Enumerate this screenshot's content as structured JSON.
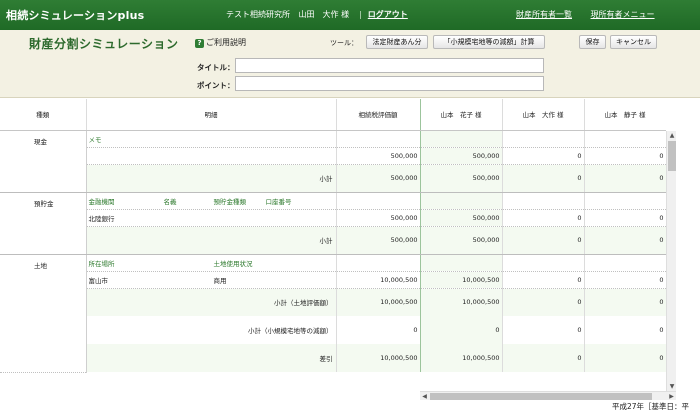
{
  "header": {
    "app_title": "相続シミュレーションplus",
    "office": "テスト相続研究所",
    "user_name": "山田　大作 様",
    "logout": "ログアウト",
    "nav": {
      "property_owner_list": "財産所有者一覧",
      "owner_menu": "現所有者メニュー"
    }
  },
  "subheader": {
    "page_title": "財産分割シミュレーション",
    "help": "ご利用説明",
    "tools_label": "ツール：",
    "tool_legal_share": "法定財産あん分",
    "tool_small_land": "「小規模宅地等の減額」計算",
    "save": "保存",
    "cancel": "キャンセル",
    "title_label": "タイトル：",
    "title_value": "",
    "point_label": "ポイント：",
    "point_value": ""
  },
  "table": {
    "columns": {
      "category": "種類",
      "meisai": "明細",
      "total": "相続税評価額",
      "heirs": [
        "山本　花子 様",
        "山本　大作 様",
        "山本　静子 様"
      ]
    },
    "cash": {
      "category": "現金",
      "memo": "メモ",
      "row": {
        "total": "500,000",
        "h1": "500,000",
        "h2": "0",
        "h3": "0"
      },
      "subtotal": {
        "label": "小計",
        "total": "500,000",
        "h1": "500,000",
        "h2": "0",
        "h3": "0"
      }
    },
    "deposit": {
      "category": "預貯金",
      "headers": [
        "金融機関",
        "名義",
        "預貯金種類",
        "口座番号"
      ],
      "row": {
        "bank": "北陸銀行",
        "total": "500,000",
        "h1": "500,000",
        "h2": "0",
        "h3": "0"
      },
      "subtotal": {
        "label": "小計",
        "total": "500,000",
        "h1": "500,000",
        "h2": "0",
        "h3": "0"
      }
    },
    "land": {
      "category": "土地",
      "headers": [
        "所在場所",
        "土地使用状況"
      ],
      "row": {
        "location": "富山市",
        "usage": "商用",
        "total": "10,000,500",
        "h1": "10,000,500",
        "h2": "0",
        "h3": "0"
      },
      "subtotal_eval": {
        "label": "小計（土地評価額）",
        "total": "10,000,500",
        "h1": "10,000,500",
        "h2": "0",
        "h3": "0"
      },
      "subtotal_reduction": {
        "label": "小計（小規模宅地等の減額）",
        "total": "0",
        "h1": "0",
        "h2": "0",
        "h3": "0"
      },
      "diff": {
        "label": "差引",
        "total": "10,000,500",
        "h1": "10,000,500",
        "h2": "0",
        "h3": "0"
      }
    }
  },
  "footer": {
    "note": "平成27年［基準日：平"
  }
}
